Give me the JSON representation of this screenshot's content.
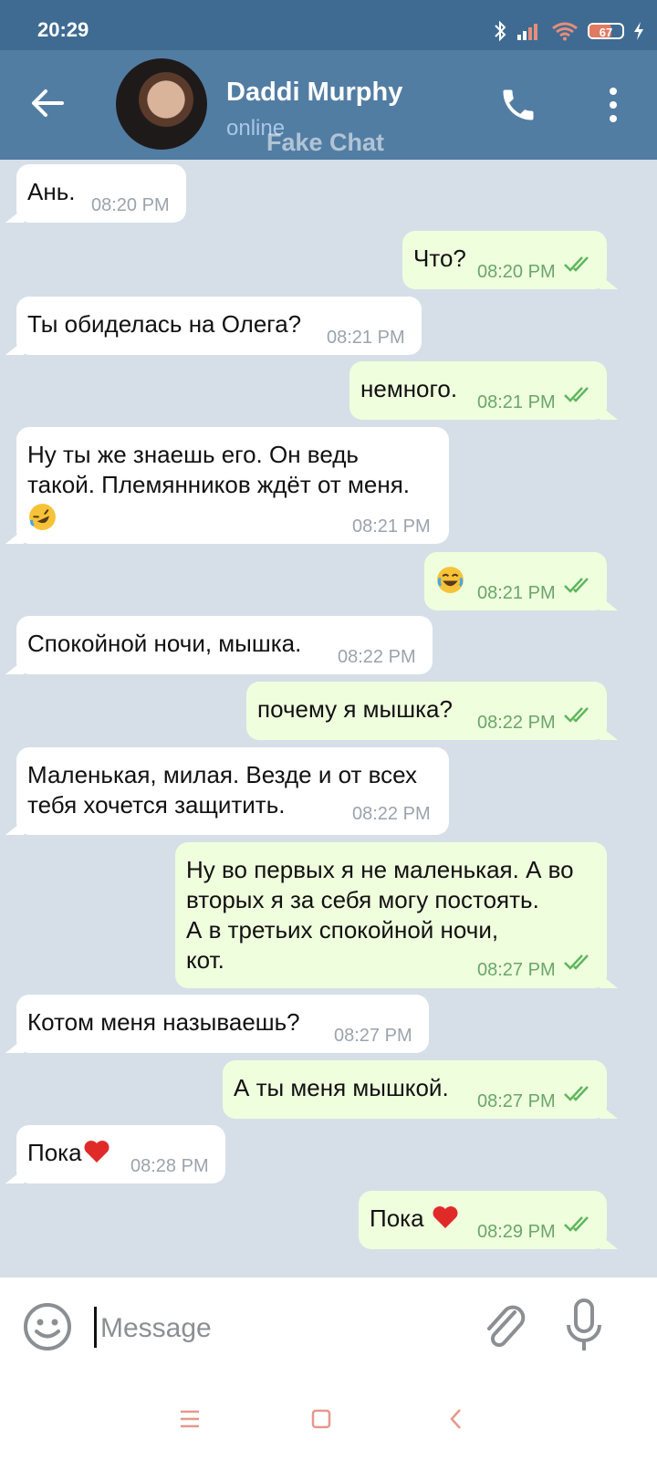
{
  "status_bar": {
    "time": "20:29",
    "battery": "67",
    "icons": [
      "bluetooth-icon",
      "signal-icon",
      "wifi-icon",
      "battery-icon",
      "charging-icon"
    ]
  },
  "header": {
    "contact_name": "Daddi Murphy",
    "status": "online",
    "watermark": "Fake Chat",
    "icons": [
      "back-arrow-icon",
      "phone-icon",
      "more-vertical-icon"
    ]
  },
  "messages": [
    {
      "dir": "in",
      "lines": [
        "Ань."
      ],
      "time": "08:20 PM"
    },
    {
      "dir": "out",
      "lines": [
        "Что?"
      ],
      "time": "08:20 PM"
    },
    {
      "dir": "in",
      "lines": [
        "Ты обиделась на Олега?"
      ],
      "time": "08:21 PM"
    },
    {
      "dir": "out",
      "lines": [
        "немного."
      ],
      "time": "08:21 PM"
    },
    {
      "dir": "in",
      "lines": [
        "Ну ты же знаешь его. Он ведь",
        "такой. Племянников ждёт от меня."
      ],
      "emoji": "rolling-on-floor-laughing-emoji",
      "time": "08:21 PM"
    },
    {
      "dir": "out",
      "lines": [
        ""
      ],
      "emoji": "tears-of-joy-emoji",
      "time": "08:21 PM"
    },
    {
      "dir": "in",
      "lines": [
        "Спокойной ночи, мышка."
      ],
      "time": "08:22 PM"
    },
    {
      "dir": "out",
      "lines": [
        "почему я мышка?"
      ],
      "time": "08:22 PM"
    },
    {
      "dir": "in",
      "lines": [
        "Маленькая, милая. Везде и от всех",
        "тебя хочется защитить."
      ],
      "time": "08:22 PM"
    },
    {
      "dir": "out",
      "lines": [
        "Ну во первых я не маленькая. А во",
        "вторых я за себя могу постоять.",
        "А в третьих спокойной ночи,",
        "кот."
      ],
      "time": "08:27 PM"
    },
    {
      "dir": "in",
      "lines": [
        "Котом меня называешь?"
      ],
      "time": "08:27 PM"
    },
    {
      "dir": "out",
      "lines": [
        "А ты меня мышкой."
      ],
      "time": "08:27 PM"
    },
    {
      "dir": "in",
      "lines": [
        "Пока"
      ],
      "emoji": "red-heart-emoji",
      "time": "08:28 PM"
    },
    {
      "dir": "out",
      "lines": [
        "Пока "
      ],
      "emoji": "red-heart-emoji",
      "time": "08:29 PM"
    }
  ],
  "composer": {
    "placeholder": "Message",
    "icons": [
      "emoji-smiley-icon",
      "paperclip-icon",
      "microphone-icon"
    ]
  },
  "nav_bar": {
    "icons": [
      "menu-lines-icon",
      "home-square-icon",
      "back-chevron-icon"
    ]
  },
  "colors": {
    "status_bar": "#3f6b92",
    "header": "#527da3",
    "chat_background": "#d6dfe8",
    "incoming_bubble": "#ffffff",
    "outgoing_bubble": "#effedd",
    "outgoing_time": "#6aa66b",
    "incoming_time": "#9ba3ac",
    "nav_icons": "#e5988b"
  }
}
